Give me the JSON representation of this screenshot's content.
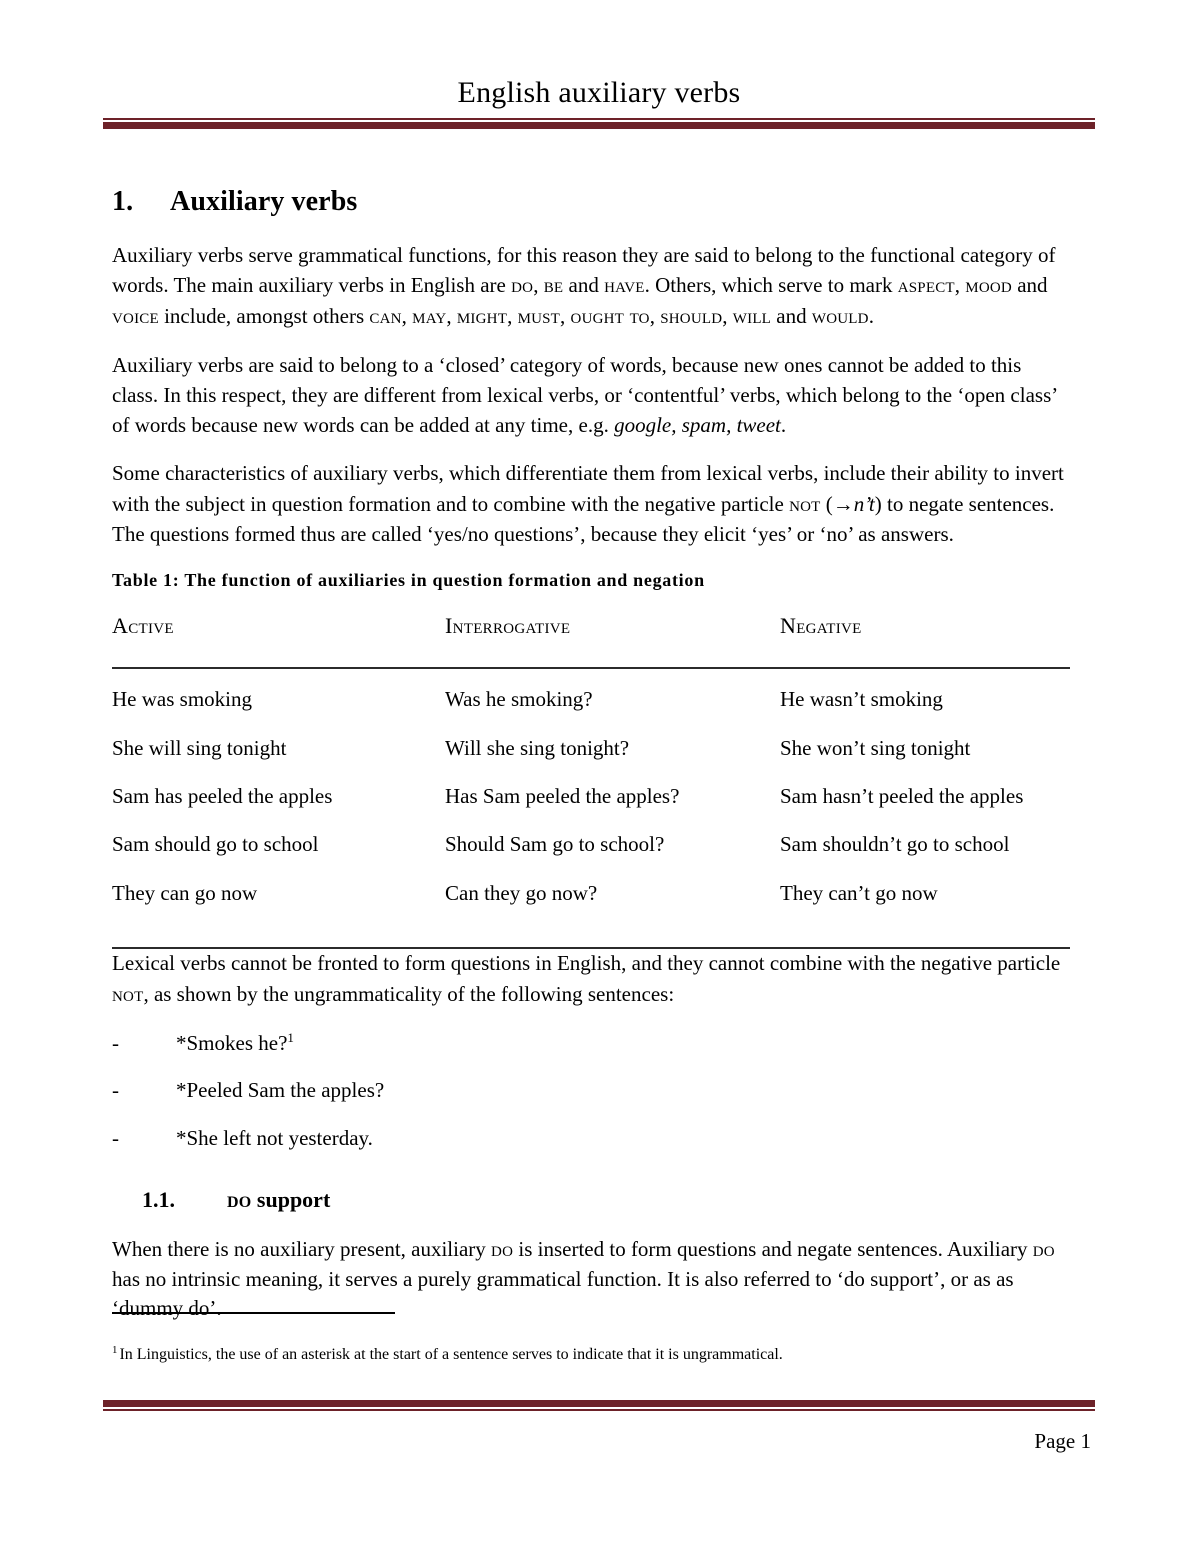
{
  "header": {
    "title": "English auxiliary verbs",
    "rule_color": "#6D2229"
  },
  "section": {
    "number": "1.",
    "title": "Auxiliary verbs"
  },
  "paragraphs": {
    "p1": {
      "a": "Auxiliary verbs serve grammatical functions, for this reason they are said to belong to the functional category of words. The main auxiliary verbs in English are ",
      "sc1": "do",
      "b": ", ",
      "sc2": "be",
      "c": " and ",
      "sc3": "have",
      "d": ". Others, which serve to mark ",
      "sc4": "aspect",
      "e": ", ",
      "sc5": "mood",
      "f": " and ",
      "sc6": "voice",
      "g": " include, amongst others ",
      "sc7": "can",
      "h": ", ",
      "sc8": "may",
      "i": ", ",
      "sc9": "might",
      "j": ", ",
      "sc10": "must",
      "k": ", ",
      "sc11": "ought to",
      "l": ", ",
      "sc12": "should",
      "m": ", ",
      "sc13": "will",
      "n": " and ",
      "sc14": "would",
      "o": "."
    },
    "p2": {
      "a": "Auxiliary verbs are said to belong to a ‘closed’ category of words, because new ones cannot be added to this class. In this respect, they are different from lexical verbs, or ‘contentful’ verbs, which belong to the ‘open class’ of words because new words can be added at any time, e.g. ",
      "it1": "google, spam, tweet",
      "b": "."
    },
    "p3": {
      "a": "Some characteristics of auxiliary verbs, which differentiate them from lexical verbs, include their ability to invert with the subject in question formation and to combine with the negative particle ",
      "sc1": "not",
      "b": " (→",
      "it1": "n’t",
      "c": ") to negate sentences. The questions formed thus are called ‘yes/no questions’, because they elicit ‘yes’ or ‘no’ as answers."
    },
    "p4": {
      "a": "Lexical verbs cannot be fronted to form questions in English, and they cannot combine with the negative particle ",
      "sc1": "not",
      "b": ", as shown by the ungrammaticality of the following sentences:"
    },
    "p5": {
      "a": "When there is no auxiliary present, auxiliary ",
      "sc1": "do",
      "b": " is inserted to form questions and negate sentences. Auxiliary ",
      "sc2": "do",
      "c": " has no intrinsic meaning, it serves a purely grammatical function. It is also referred to ‘do support’, or as as ‘dummy do’."
    }
  },
  "table": {
    "caption": "Table 1: The function of auxiliaries in question formation and negation",
    "headers": [
      "Active",
      "Interrogative",
      "Negative"
    ],
    "rows": [
      [
        "He was smoking",
        "Was he smoking?",
        "He wasn’t smoking"
      ],
      [
        "She will sing tonight",
        "Will she sing tonight?",
        "She won’t sing tonight"
      ],
      [
        "Sam has peeled the apples",
        "Has Sam peeled the apples?",
        "Sam hasn’t peeled the apples"
      ],
      [
        "Sam should go to school",
        "Should Sam go to school?",
        "Sam shouldn’t go to school"
      ],
      [
        "They can go now",
        "Can they go now?",
        "They can’t go now"
      ]
    ]
  },
  "examples": {
    "marker": "-",
    "items": [
      {
        "text": "*Smokes he?",
        "footnote_ref": "1"
      },
      {
        "text": "*Peeled Sam the apples?",
        "footnote_ref": ""
      },
      {
        "text": "*She left not yesterday.",
        "footnote_ref": ""
      }
    ]
  },
  "subsection": {
    "number": "1.1.",
    "title_sc": "do",
    "title_rest": " support"
  },
  "footnote": {
    "ref": "1",
    "text": "In Linguistics, the use of an asterisk at the start of a sentence serves to indicate that it is ungrammatical."
  },
  "footer": {
    "page_label": "Page 1"
  }
}
